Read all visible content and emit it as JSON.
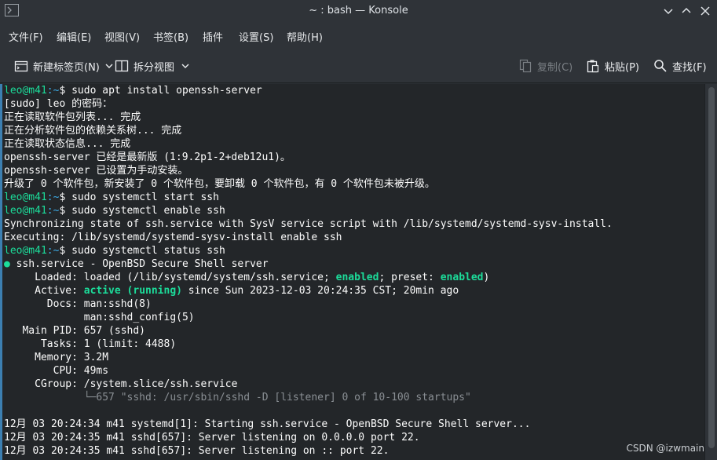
{
  "window": {
    "title": "~ : bash — Konsole",
    "app_icon": "konsole-icon",
    "controls": [
      "minimize-icon",
      "maximize-icon",
      "close-icon"
    ]
  },
  "menu": {
    "file": "文件(F)",
    "edit": "编辑(E)",
    "view": "视图(V)",
    "bookmarks": "书签(B)",
    "plugins": "插件",
    "settings": "设置(S)",
    "help": "帮助(H)"
  },
  "toolbar": {
    "new_tab": "新建标签页(N)",
    "split_view": "拆分视图",
    "copy": "复制(C)",
    "paste": "粘贴(P)",
    "find": "查找(F)"
  },
  "terminal": {
    "prompt_user": "leo@m41",
    "prompt_dir": ":~",
    "prompt_symbol": "$ ",
    "cmd1": "sudo apt install openssh-server",
    "l2": "[sudo] leo 的密码：",
    "l3": "正在读取软件包列表... 完成",
    "l4": "正在分析软件包的依赖关系树... 完成",
    "l5": "正在读取状态信息... 完成",
    "l6": "openssh-server 已经是最新版 (1:9.2p1-2+deb12u1)。",
    "l7": "openssh-server 已设置为手动安装。",
    "l8": "升级了 0 个软件包，新安装了 0 个软件包，要卸载 0 个软件包，有 0 个软件包未被升级。",
    "cmd2": "sudo systemctl start ssh",
    "cmd3": "sudo systemctl enable ssh",
    "l11": "Synchronizing state of ssh.service with SysV service script with /lib/systemd/systemd-sysv-install.",
    "l12": "Executing: /lib/systemd/systemd-sysv-install enable ssh",
    "cmd4": "sudo systemctl status ssh",
    "l14_bullet": "●",
    "l14": " ssh.service - OpenBSD Secure Shell server",
    "l15_a": "     Loaded: loaded (/lib/systemd/system/ssh.service; ",
    "l15_b": "enabled",
    "l15_c": "; preset: ",
    "l15_d": "enabled",
    "l15_e": ")",
    "l16_a": "     Active: ",
    "l16_b": "active (running)",
    "l16_c": " since Sun 2023-12-03 20:24:35 CST; 20min ago",
    "l17": "       Docs: man:sshd(8)",
    "l18": "             man:sshd_config(5)",
    "l19": "   Main PID: 657 (sshd)",
    "l20": "      Tasks: 1 (limit: 4488)",
    "l21": "     Memory: 3.2M",
    "l22": "        CPU: 49ms",
    "l23": "     CGroup: /system.slice/ssh.service",
    "l24": "             └─657 \"sshd: /usr/sbin/sshd -D [listener] 0 of 10-100 startups\"",
    "l26": "12月 03 20:24:34 m41 systemd[1]: Starting ssh.service - OpenBSD Secure Shell server...",
    "l27": "12月 03 20:24:35 m41 sshd[657]: Server listening on 0.0.0.0 port 22.",
    "l28": "12月 03 20:24:35 m41 sshd[657]: Server listening on :: port 22."
  },
  "watermark": "CSDN @izwmain"
}
